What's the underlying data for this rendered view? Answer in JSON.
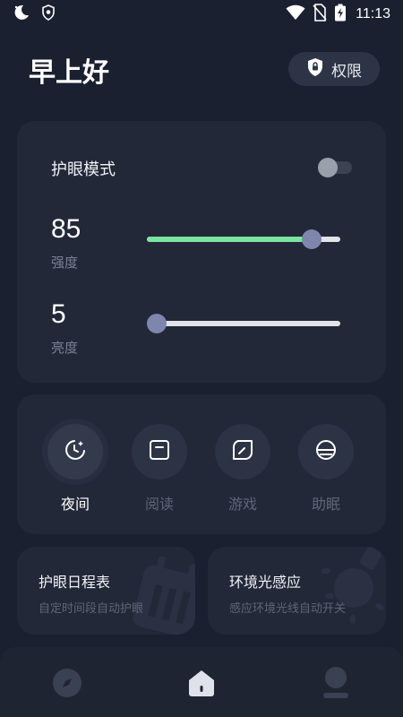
{
  "status_bar": {
    "time": "11:13",
    "icons": [
      "moon-icon",
      "shield-icon",
      "wifi-icon",
      "no-sim-icon",
      "battery-charging-icon"
    ]
  },
  "header": {
    "greeting": "早上好",
    "permission_label": "权限",
    "permission_icon": "shield-lock-icon"
  },
  "eye_care": {
    "title": "护眼模式",
    "enabled": false,
    "intensity": {
      "value": "85",
      "label": "强度",
      "level": 0.85
    },
    "brightness": {
      "value": "5",
      "label": "亮度",
      "level": 0.05
    }
  },
  "modes": [
    {
      "label": "夜间",
      "icon": "moon-clock-icon",
      "active": true
    },
    {
      "label": "阅读",
      "icon": "book-icon",
      "active": false
    },
    {
      "label": "游戏",
      "icon": "leaf-icon",
      "active": false
    },
    {
      "label": "助眠",
      "icon": "sunset-icon",
      "active": false
    }
  ],
  "tools": [
    {
      "title": "护眼日程表",
      "subtitle": "自定时间段自动护眼",
      "icon": "calendar-icon"
    },
    {
      "title": "环境光感应",
      "subtitle": "感应环境光线自动开关",
      "icon": "light-sensor-icon"
    }
  ],
  "bottom_nav": [
    {
      "icon": "compass-icon",
      "active": false
    },
    {
      "icon": "home-icon",
      "active": true
    },
    {
      "icon": "profile-icon",
      "active": false
    }
  ],
  "colors": {
    "background": "#1b2030",
    "card": "#222838",
    "slider_fill": "#7ce3a0",
    "slider_thumb": "#7e86ad"
  }
}
